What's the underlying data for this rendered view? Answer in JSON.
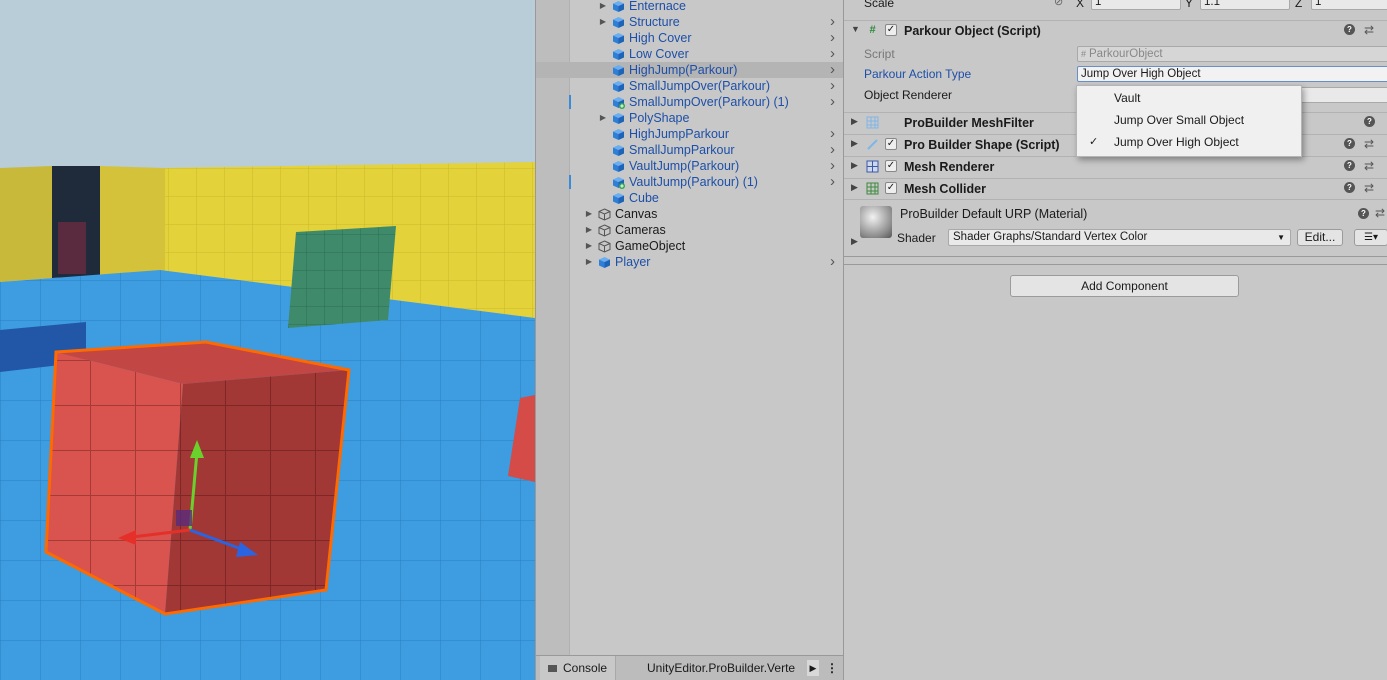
{
  "hierarchy": {
    "items": [
      {
        "label": "Enternace",
        "type": "prefab",
        "foldout": true,
        "chevron": false,
        "marked": false
      },
      {
        "label": "Structure",
        "type": "prefab",
        "foldout": true,
        "chevron": true,
        "marked": false
      },
      {
        "label": "High Cover",
        "type": "prefab",
        "foldout": false,
        "chevron": true,
        "marked": false
      },
      {
        "label": "Low Cover",
        "type": "prefab",
        "foldout": false,
        "chevron": true,
        "marked": false
      },
      {
        "label": "HighJump(Parkour)",
        "type": "prefab",
        "foldout": false,
        "chevron": true,
        "marked": false,
        "selected": true
      },
      {
        "label": "SmallJumpOver(Parkour)",
        "type": "prefab",
        "foldout": false,
        "chevron": true,
        "marked": false
      },
      {
        "label": "SmallJumpOver(Parkour) (1)",
        "type": "prefab-added",
        "foldout": false,
        "chevron": true,
        "marked": true
      },
      {
        "label": "PolyShape",
        "type": "prefab",
        "foldout": true,
        "chevron": false,
        "marked": false
      },
      {
        "label": "HighJumpParkour",
        "type": "prefab",
        "foldout": false,
        "chevron": true,
        "marked": false
      },
      {
        "label": "SmallJumpParkour",
        "type": "prefab",
        "foldout": false,
        "chevron": true,
        "marked": false
      },
      {
        "label": "VaultJump(Parkour)",
        "type": "prefab",
        "foldout": false,
        "chevron": true,
        "marked": false
      },
      {
        "label": "VaultJump(Parkour) (1)",
        "type": "prefab-added",
        "foldout": false,
        "chevron": true,
        "marked": true
      },
      {
        "label": "Cube",
        "type": "prefab",
        "foldout": false,
        "chevron": false,
        "marked": false
      },
      {
        "label": "Canvas",
        "type": "plain",
        "foldout": true,
        "chevron": false,
        "marked": false,
        "root": true
      },
      {
        "label": "Cameras",
        "type": "plain",
        "foldout": true,
        "chevron": false,
        "marked": false,
        "root": true
      },
      {
        "label": "GameObject",
        "type": "plain",
        "foldout": true,
        "chevron": false,
        "marked": false,
        "root": true
      },
      {
        "label": "Player",
        "type": "prefab",
        "foldout": true,
        "chevron": true,
        "marked": false,
        "root": true
      }
    ]
  },
  "console": {
    "tab_label": "Console",
    "message": "UnityEditor.ProBuilder.Verte"
  },
  "inspector": {
    "scale": {
      "label": "Scale",
      "x_label": "X",
      "x": "1",
      "y_label": "Y",
      "y": "1.1",
      "z_label": "Z",
      "z": "1"
    },
    "parkour": {
      "title": "Parkour Object (Script)",
      "script_label": "Script",
      "script_value": "ParkourObject",
      "action_label": "Parkour Action Type",
      "action_value": "Jump Over High Object",
      "renderer_label": "Object Renderer"
    },
    "components": [
      {
        "title": "ProBuilder MeshFilter",
        "icon": "mesh-filter-icon",
        "checkbox": false
      },
      {
        "title": "Pro Builder Shape (Script)",
        "icon": "script-icon",
        "checkbox": true
      },
      {
        "title": "Mesh Renderer",
        "icon": "mesh-renderer-icon",
        "checkbox": true
      },
      {
        "title": "Mesh Collider",
        "icon": "mesh-collider-icon",
        "checkbox": true
      }
    ],
    "material": {
      "title": "ProBuilder Default URP (Material)",
      "shader_label": "Shader",
      "shader_value": "Shader Graphs/Standard Vertex Color",
      "edit_label": "Edit..."
    },
    "add_component_label": "Add Component"
  },
  "dropdown": {
    "options": [
      {
        "label": "Vault",
        "checked": false
      },
      {
        "label": "Jump Over Small Object",
        "checked": false
      },
      {
        "label": "Jump Over High Object",
        "checked": true
      }
    ]
  },
  "colors": {
    "prefab_text": "#1d4fa8",
    "selection": "#b4b4b4",
    "outline": "#ff6a00",
    "ground": "#3e9ce0",
    "wall": "#e3d23a"
  }
}
